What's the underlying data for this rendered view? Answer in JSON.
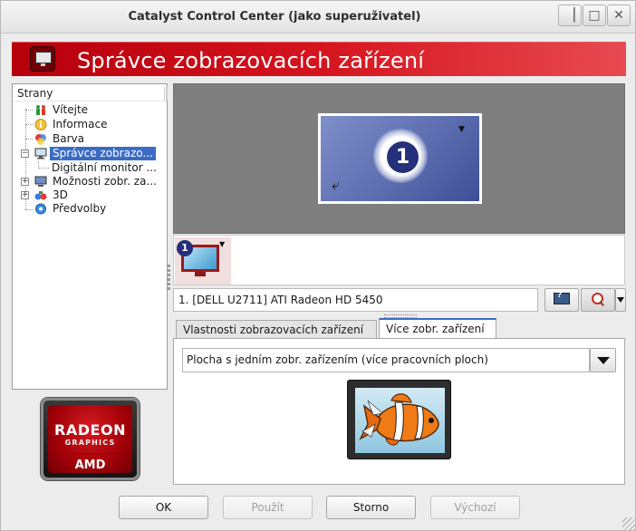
{
  "window": {
    "title": "Catalyst Control Center (jako superuživatel)"
  },
  "header": {
    "title": "Správce zobrazovacích zařízení"
  },
  "tree": {
    "header": "Strany",
    "items": [
      {
        "label": "Vítejte",
        "icon": "welcome-people-icon"
      },
      {
        "label": "Informace",
        "icon": "info-icon"
      },
      {
        "label": "Barva",
        "icon": "color-wheel-icon"
      },
      {
        "label": "Správce zobrazo...",
        "icon": "display-manager-icon",
        "selected": true
      },
      {
        "label": "Digitální monitor ...",
        "icon": null
      },
      {
        "label": "Možnosti zobr. za...",
        "icon": "display-options-icon"
      },
      {
        "label": "3D",
        "icon": "3d-icon"
      },
      {
        "label": "Předvolby",
        "icon": "preferences-icon"
      }
    ]
  },
  "logo": {
    "line1": "RADEON",
    "line2": "GRAPHICS",
    "line3": "AMD"
  },
  "preview": {
    "display_number": "1"
  },
  "thumbnail": {
    "display_number": "1"
  },
  "display_selector": {
    "value": "1.  [DELL U2711] ATI Radeon HD 5450"
  },
  "tabs": [
    {
      "label": "Vlastnosti zobrazovacích zařízení",
      "active": false
    },
    {
      "label": "Více zobr. zařízení",
      "active": true
    }
  ],
  "multi_display": {
    "mode_value": "Plocha s jedním zobr. zařízením (více pracovních ploch)"
  },
  "buttons": {
    "ok": "OK",
    "apply": "Použít",
    "cancel": "Storno",
    "defaults": "Výchozí"
  },
  "colors": {
    "banner_red": "#cc0a14",
    "selection_blue": "#3a6cc6",
    "display_number_bg": "#25307a"
  }
}
